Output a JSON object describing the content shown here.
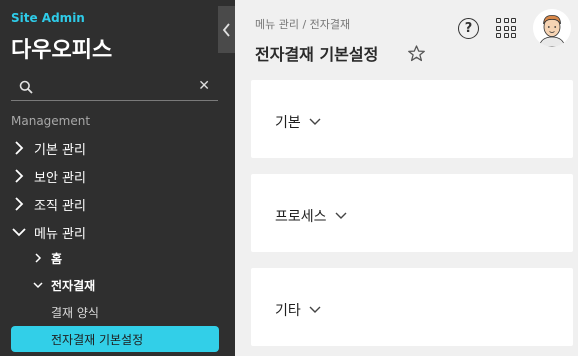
{
  "sidebar": {
    "site_admin": "Site Admin",
    "brand": "다우오피스",
    "search": {
      "placeholder": "",
      "clear_icon": "close-icon"
    },
    "section_label": "Management",
    "items": [
      {
        "label": "기본 관리",
        "expanded": false
      },
      {
        "label": "보안 관리",
        "expanded": false
      },
      {
        "label": "조직 관리",
        "expanded": false
      },
      {
        "label": "메뉴 관리",
        "expanded": true
      }
    ],
    "sub_items": [
      {
        "label": "홈",
        "expanded": false
      },
      {
        "label": "전자결재",
        "expanded": true
      }
    ],
    "leaf_items": [
      {
        "label": "결재 양식"
      },
      {
        "label": "전자결재 기본설정",
        "active": true
      }
    ],
    "accent_color": "#32cfe8"
  },
  "header": {
    "breadcrumb": "메뉴 관리 / 전자결재",
    "title": "전자결재 기본설정",
    "help_label": "?"
  },
  "cards": [
    {
      "label": "기본"
    },
    {
      "label": "프로세스"
    },
    {
      "label": "기타"
    }
  ]
}
